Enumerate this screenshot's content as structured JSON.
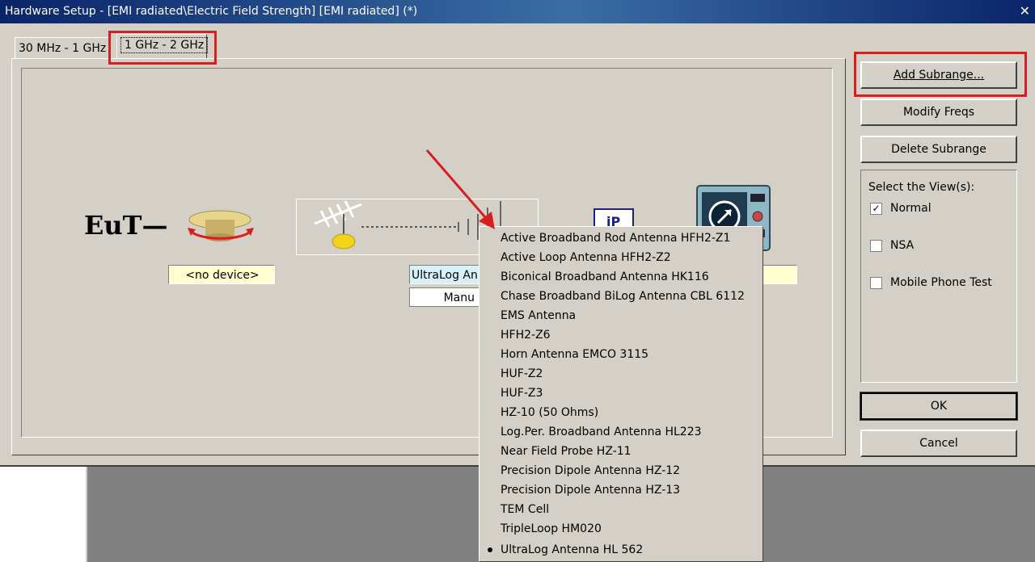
{
  "window": {
    "title": "Hardware Setup  -  [EMI radiated\\Electric Field Strength] [EMI radiated] (*)",
    "close_glyph": "✕"
  },
  "tabs": [
    {
      "label": "30 MHz - 1 GHz",
      "selected": false
    },
    {
      "label": "1 GHz - 2 GHz",
      "selected": true
    }
  ],
  "setup": {
    "eut_label": "EuT—",
    "turntable_device": "<no device>",
    "antenna_device": "UltraLog An",
    "antenna_mode": "Manu",
    "receiver_device": ""
  },
  "buttons": {
    "add_subrange": "Add Subrange...",
    "modify_freqs": "Modify Freqs",
    "delete_subrange": "Delete Subrange",
    "ok": "OK",
    "cancel": "Cancel"
  },
  "views": {
    "title": "Select the View(s):",
    "options": [
      {
        "label": "Normal",
        "checked": true
      },
      {
        "label": "NSA",
        "checked": false
      },
      {
        "label": "Mobile Phone Test",
        "checked": false
      }
    ]
  },
  "antenna_menu": {
    "items": [
      {
        "label": "Active Broadband Rod Antenna HFH2-Z1",
        "selected": false
      },
      {
        "label": "Active Loop Antenna HFH2-Z2",
        "selected": false
      },
      {
        "label": "Biconical Broadband Antenna HK116",
        "selected": false
      },
      {
        "label": "Chase Broadband BiLog Antenna CBL 6112",
        "selected": false
      },
      {
        "label": "EMS Antenna",
        "selected": false
      },
      {
        "label": "HFH2-Z6",
        "selected": false
      },
      {
        "label": "Horn Antenna EMCO 3115",
        "selected": false
      },
      {
        "label": "HUF-Z2",
        "selected": false
      },
      {
        "label": "HUF-Z3",
        "selected": false
      },
      {
        "label": "HZ-10 (50 Ohms)",
        "selected": false
      },
      {
        "label": "Log.Per. Broadband Antenna HL223",
        "selected": false
      },
      {
        "label": "Near Field Probe HZ-11",
        "selected": false
      },
      {
        "label": "Precision Dipole Antenna HZ-12",
        "selected": false
      },
      {
        "label": "Precision Dipole Antenna HZ-13",
        "selected": false
      },
      {
        "label": "TEM Cell",
        "selected": false
      },
      {
        "label": "TripleLoop HM020",
        "selected": false
      },
      {
        "label": "UltraLog Antenna HL 562",
        "selected": true
      }
    ]
  },
  "colors": {
    "highlight_red": "#d81e1e",
    "title_bar": "#0a246a",
    "device_field": "#ffffd2",
    "antenna_field": "#d6f2f8"
  }
}
